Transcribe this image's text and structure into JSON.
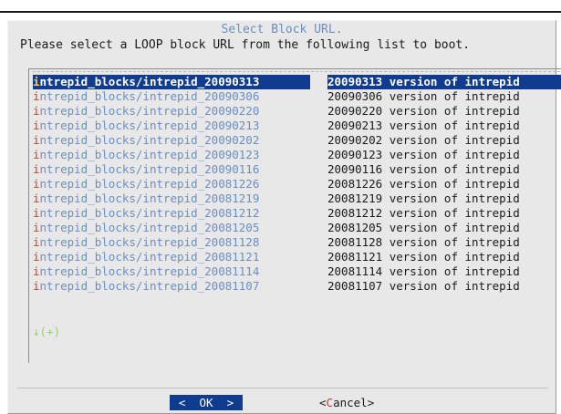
{
  "dialog": {
    "title": "Select Block URL.",
    "prompt": "Please select a LOOP block URL from the following list to boot."
  },
  "list": {
    "items": [
      {
        "tag": "intrepid_blocks/intrepid_20090313",
        "desc": "20090313 version of intrepid",
        "selected": true
      },
      {
        "tag": "intrepid_blocks/intrepid_20090306",
        "desc": "20090306 version of intrepid"
      },
      {
        "tag": "intrepid_blocks/intrepid_20090220",
        "desc": "20090220 version of intrepid"
      },
      {
        "tag": "intrepid_blocks/intrepid_20090213",
        "desc": "20090213 version of intrepid"
      },
      {
        "tag": "intrepid_blocks/intrepid_20090202",
        "desc": "20090202 version of intrepid"
      },
      {
        "tag": "intrepid_blocks/intrepid_20090123",
        "desc": "20090123 version of intrepid"
      },
      {
        "tag": "intrepid_blocks/intrepid_20090116",
        "desc": "20090116 version of intrepid"
      },
      {
        "tag": "intrepid_blocks/intrepid_20081226",
        "desc": "20081226 version of intrepid"
      },
      {
        "tag": "intrepid_blocks/intrepid_20081219",
        "desc": "20081219 version of intrepid"
      },
      {
        "tag": "intrepid_blocks/intrepid_20081212",
        "desc": "20081212 version of intrepid"
      },
      {
        "tag": "intrepid_blocks/intrepid_20081205",
        "desc": "20081205 version of intrepid"
      },
      {
        "tag": "intrepid_blocks/intrepid_20081128",
        "desc": "20081128 version of intrepid"
      },
      {
        "tag": "intrepid_blocks/intrepid_20081121",
        "desc": "20081121 version of intrepid"
      },
      {
        "tag": "intrepid_blocks/intrepid_20081114",
        "desc": "20081114 version of intrepid"
      },
      {
        "tag": "intrepid_blocks/intrepid_20081107",
        "desc": "20081107 version of intrepid"
      }
    ],
    "scroll_indicator": "↓(+)"
  },
  "buttons": {
    "ok": {
      "left": "<",
      "label": "OK",
      "right": ">"
    },
    "cancel": {
      "open": "<",
      "hotkey": "C",
      "rest": "ancel",
      "close": ">"
    }
  },
  "colors": {
    "selection_bg": "#103c8f",
    "tag_text": "#6b8fc2",
    "hotkey": "#cc3b2b",
    "scroll_indicator": "#8ed46a",
    "dialog_bg": "#e8e8e8"
  }
}
